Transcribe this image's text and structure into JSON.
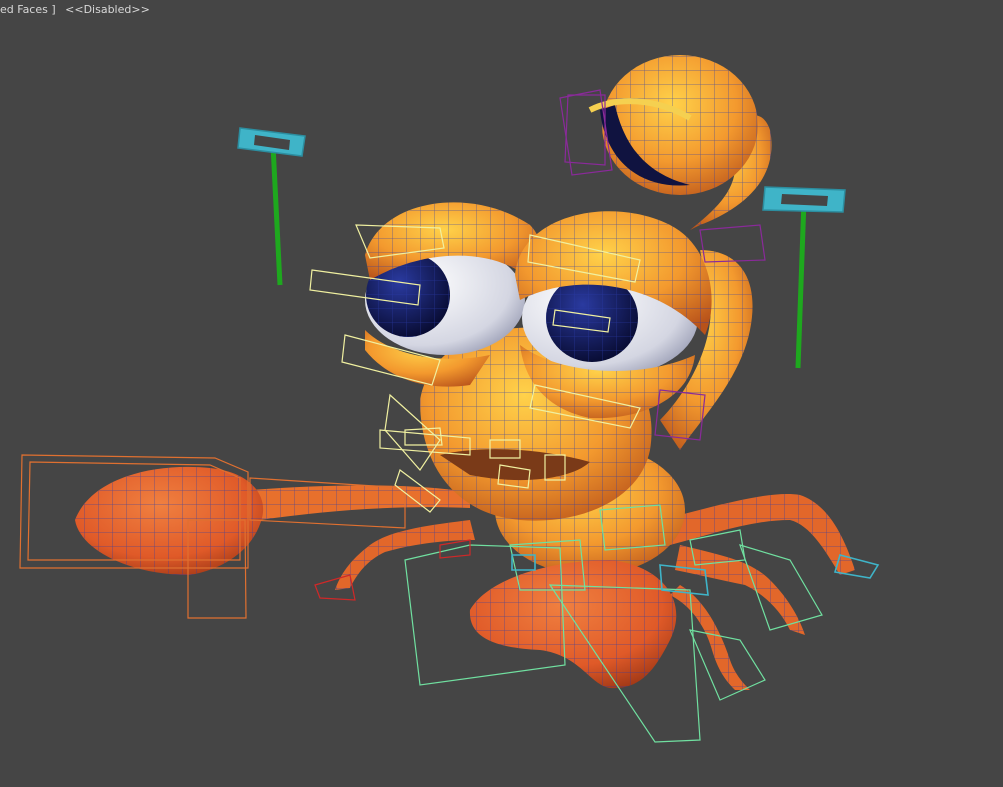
{
  "viewport": {
    "shading_label": "ed Faces ]",
    "status_label": "<<Disabled>>"
  },
  "colors": {
    "background": "#454545",
    "body_orange": "#f08a2a",
    "body_yellow": "#f5c23a",
    "claw_red": "#e0562a",
    "wire_blue": "#2a3aa8",
    "pupil_navy": "#0d1250",
    "eye_white": "#e8e8f0",
    "handle_cyan": "#3fb4c8",
    "handle_green": "#1ea81e",
    "bone_box_orange": "#e07030",
    "bone_box_yellow": "#f0f0a0",
    "bone_box_green": "#70e0a0",
    "bone_box_purple": "#8a2a9a",
    "bone_box_red": "#d02828"
  },
  "icons": [
    "ik-handle-left-icon",
    "ik-handle-right-icon"
  ]
}
